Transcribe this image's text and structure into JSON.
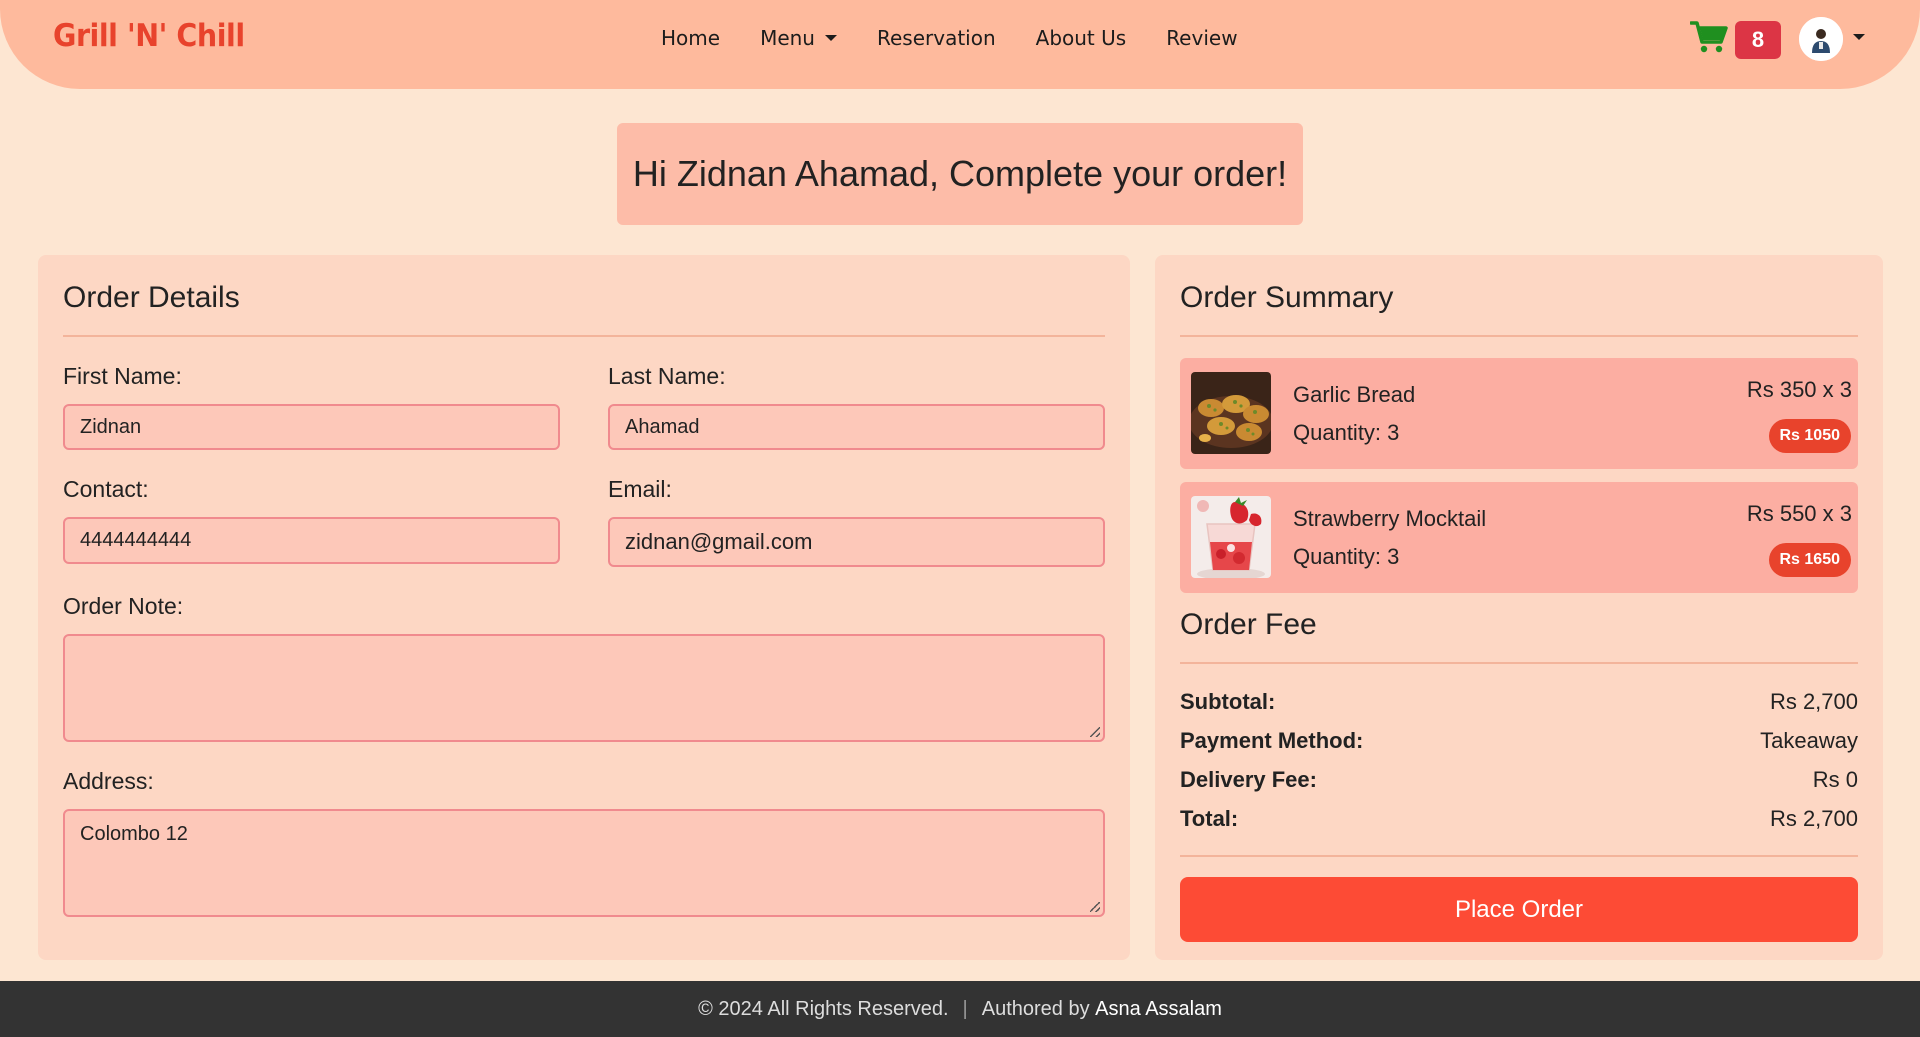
{
  "brand": "Grill 'N' Chill",
  "nav": {
    "links": [
      "Home",
      "Menu",
      "Reservation",
      "About Us",
      "Review"
    ],
    "cart_count": "8",
    "colors": {
      "cart": "#1f8f1f",
      "badge": "#dc3545"
    }
  },
  "greeting": "Hi Zidnan Ahamad, Complete your order!",
  "order_details": {
    "title": "Order Details",
    "first_name_label": "First Name:",
    "first_name": "Zidnan",
    "last_name_label": "Last Name:",
    "last_name": "Ahamad",
    "contact_label": "Contact:",
    "contact": "4444444444",
    "email_label": "Email:",
    "email": "zidnan@gmail.com",
    "note_label": "Order Note:",
    "note": "",
    "address_label": "Address:",
    "address": "Colombo 12"
  },
  "order_summary": {
    "title": "Order Summary",
    "items": [
      {
        "name": "Garlic Bread",
        "quantity": "Quantity: 3",
        "price": "Rs 350 x 3",
        "total": "Rs 1050",
        "image": "garlic-bread-image"
      },
      {
        "name": "Strawberry Mocktail",
        "quantity": "Quantity: 3",
        "price": "Rs 550 x 3",
        "total": "Rs 1650",
        "image": "strawberry-mocktail-image"
      }
    ],
    "fee_title": "Order Fee",
    "fees": {
      "subtotal_label": "Subtotal:",
      "subtotal": "Rs 2,700",
      "payment_label": "Payment Method:",
      "payment": "Takeaway",
      "delivery_label": "Delivery Fee:",
      "delivery": "Rs 0",
      "total_label": "Total:",
      "total": "Rs 2,700"
    },
    "place_order": "Place Order"
  },
  "footer": {
    "copyright": "© 2024 All Rights Reserved.",
    "separator": "|",
    "authored_by": "Authored by",
    "author": "Asna Assalam"
  }
}
